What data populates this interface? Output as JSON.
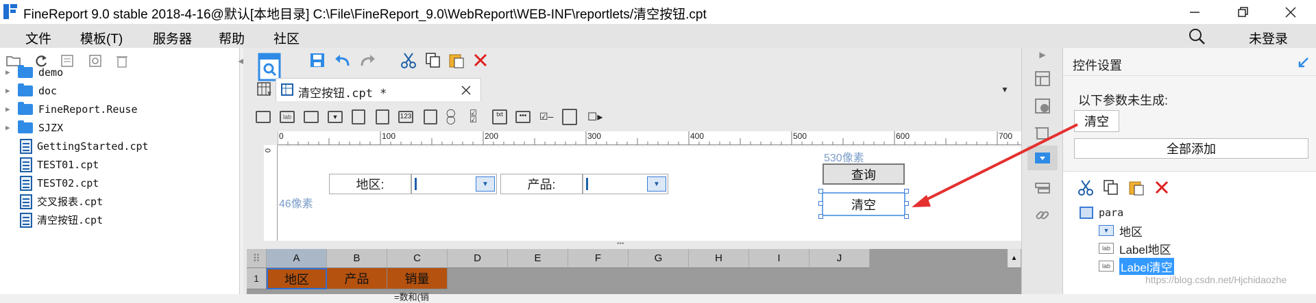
{
  "window": {
    "title": "FineReport 9.0 stable 2018-4-16@默认[本地目录]    C:\\File\\FineReport_9.0\\WebReport\\WEB-INF\\reportlets/清空按钮.cpt",
    "controls": [
      "minimize",
      "maximize",
      "close"
    ]
  },
  "menubar": {
    "items": [
      "文件",
      "模板(T)",
      "服务器",
      "帮助",
      "社区"
    ],
    "login_label": "未登录"
  },
  "file_tree": {
    "items": [
      {
        "label": "demo",
        "type": "folder"
      },
      {
        "label": "doc",
        "type": "folder"
      },
      {
        "label": "FineReport.Reuse",
        "type": "folder"
      },
      {
        "label": "SJZX",
        "type": "folder"
      },
      {
        "label": "GettingStarted.cpt",
        "type": "file"
      },
      {
        "label": "TEST01.cpt",
        "type": "file"
      },
      {
        "label": "TEST02.cpt",
        "type": "file"
      },
      {
        "label": "交叉报表.cpt",
        "type": "file"
      },
      {
        "label": "清空按钮.cpt",
        "type": "file"
      }
    ]
  },
  "editor": {
    "tab_label": "清空按钮.cpt *",
    "ruler_ticks": [
      "0",
      "100",
      "200",
      "300",
      "400",
      "500",
      "600",
      "700"
    ],
    "ruler_side_tick": "0",
    "width_hint": "530像素",
    "height_hint": "46像素",
    "params": {
      "area_label": "地区:",
      "product_label": "产品:",
      "query_button": "查询",
      "clear_button": "清空"
    }
  },
  "sheet": {
    "columns": [
      "A",
      "B",
      "C",
      "D",
      "E",
      "F",
      "G",
      "H",
      "I",
      "J"
    ],
    "row1_number": "1",
    "row1": [
      "地区",
      "产品",
      "销量"
    ],
    "row2_partial": "=数和(销"
  },
  "right_panel": {
    "title": "控件设置",
    "ungenerated_label": "以下参数未生成:",
    "ungenerated_param": "清空",
    "add_all_button": "全部添加",
    "widget_tree": {
      "root": "para",
      "children": [
        "地区",
        "Label地区",
        "Label清空"
      ],
      "selected": "Label清空"
    },
    "watermark": "https://blog.csdn.net/Hjchidaozhe"
  },
  "colors": {
    "accent": "#2f8be6",
    "header_cell": "#b5520f",
    "selection": "#3399ff",
    "arrow": "#e53030"
  }
}
